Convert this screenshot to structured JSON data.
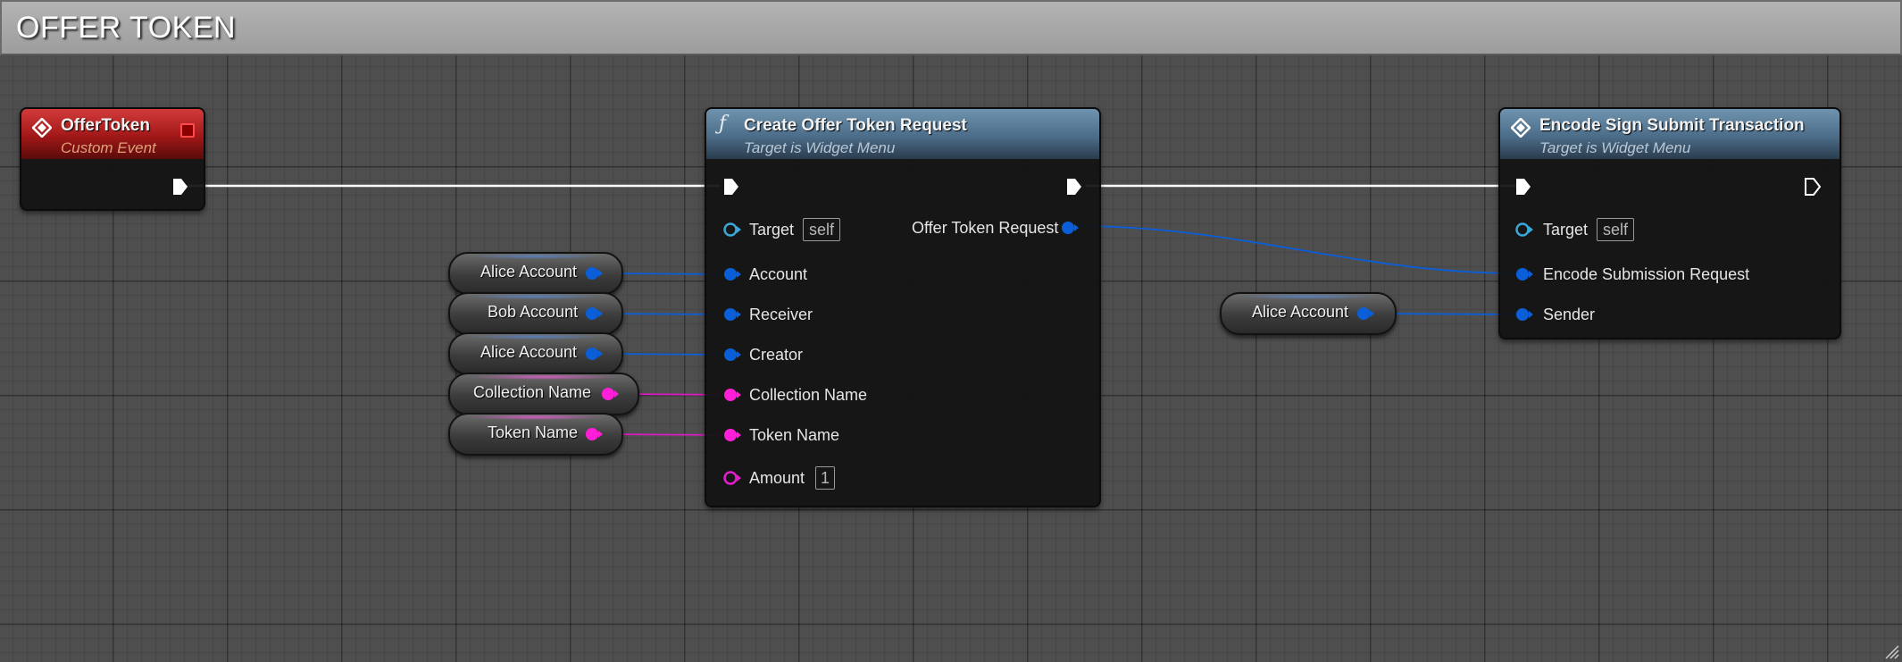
{
  "comment": {
    "title": "OFFER TOKEN"
  },
  "event_node": {
    "title": "OfferToken",
    "subtitle": "Custom Event",
    "icon": "event-diamond-icon"
  },
  "create_node": {
    "title": "Create Offer Token Request",
    "subtitle": "Target is Widget Menu",
    "icon": "function-icon",
    "inputs": {
      "target": "Target",
      "target_default": "self",
      "account": "Account",
      "receiver": "Receiver",
      "creator": "Creator",
      "collection_name": "Collection Name",
      "token_name": "Token Name",
      "amount": "Amount",
      "amount_default": "1"
    },
    "outputs": {
      "offer_token_request": "Offer Token Request"
    }
  },
  "encode_node": {
    "title": "Encode Sign Submit Transaction",
    "subtitle": "Target is Widget Menu",
    "icon": "event-diamond-icon",
    "inputs": {
      "target": "Target",
      "target_default": "self",
      "encode_submission_request": "Encode Submission Request",
      "sender": "Sender"
    }
  },
  "variables": [
    {
      "label": "Alice Account",
      "type": "object"
    },
    {
      "label": "Bob Account",
      "type": "object"
    },
    {
      "label": "Alice Account",
      "type": "object"
    },
    {
      "label": "Collection Name",
      "type": "string"
    },
    {
      "label": "Token Name",
      "type": "string"
    },
    {
      "label": "Alice Account",
      "type": "object"
    }
  ],
  "colors": {
    "object_pin": "#0a5fd8",
    "string_pin": "#ff1fd8",
    "integer_pin": "#e31ccc",
    "target_pin": "#3aa7d6",
    "exec_pin": "#ffffff",
    "event_header": "#a11818",
    "function_header": "#4c6d89"
  }
}
